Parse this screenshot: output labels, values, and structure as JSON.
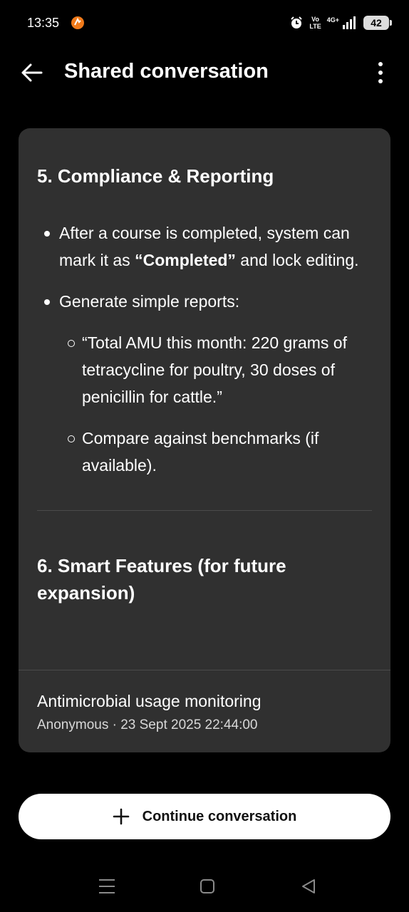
{
  "status_bar": {
    "time": "13:35",
    "volte_top": "Vo",
    "volte_bottom": "LTE",
    "network": "4G+",
    "battery": "42"
  },
  "header": {
    "title": "Shared conversation"
  },
  "content": {
    "section5_heading": "5. Compliance & Reporting",
    "bullet1_before": "After a course is completed, system can mark it as ",
    "bullet1_bold": "“Completed”",
    "bullet1_after": " and lock editing.",
    "bullet2": "Generate simple reports:",
    "sub_bullet1": "“Total AMU this month: 220 grams of tetracycline for poultry, 30 doses of penicillin for cattle.”",
    "sub_bullet2": "Compare against benchmarks (if available).",
    "section6_heading": "6. Smart Features (for future expansion)"
  },
  "conversation_meta": {
    "title": "Antimicrobial usage monitoring",
    "subtitle": "Anonymous · 23 Sept 2025 22:44:00"
  },
  "continue_button": {
    "label": "Continue conversation"
  },
  "colors": {
    "background": "#000000",
    "card": "#303030",
    "button": "#ffffff"
  },
  "icons": [
    "app-notification-icon",
    "alarm-icon",
    "signal-icon",
    "battery-icon",
    "back-arrow-icon",
    "more-vert-icon",
    "plus-icon",
    "recents-icon",
    "home-icon",
    "nav-back-icon"
  ]
}
